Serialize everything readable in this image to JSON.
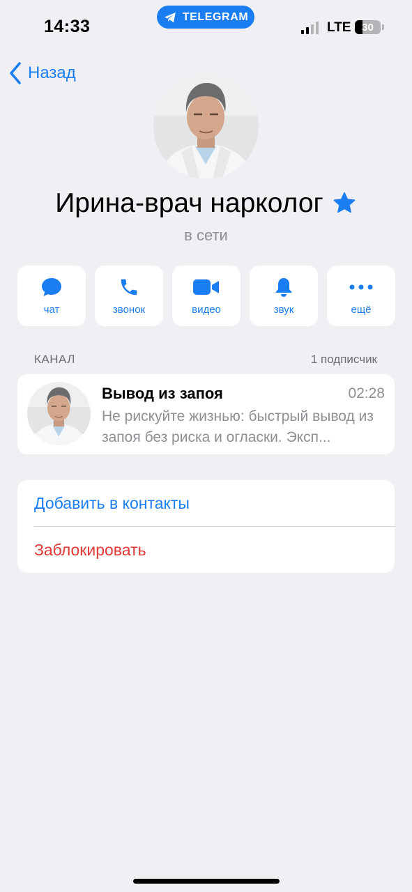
{
  "status_bar": {
    "time": "14:33",
    "app_pill": "TELEGRAM",
    "network": "LTE",
    "battery": "30",
    "battery_level": 0.3
  },
  "nav": {
    "back_label": "Назад"
  },
  "profile": {
    "name": "Ирина-врач нарколог",
    "status": "в сети",
    "badge_icon": "star-icon"
  },
  "actions": [
    {
      "label": "чат",
      "icon": "chat-bubble-icon"
    },
    {
      "label": "звонок",
      "icon": "phone-icon"
    },
    {
      "label": "видео",
      "icon": "video-camera-icon"
    },
    {
      "label": "звук",
      "icon": "bell-icon"
    },
    {
      "label": "ещё",
      "icon": "more-dots-icon"
    }
  ],
  "channel": {
    "section_title": "КАНАЛ",
    "subscribers": "1 подписчик",
    "name": "Вывод из запоя",
    "time": "02:28",
    "message": "Не рискуйте жизнью: быстрый вывод из запоя без риска и огласки. Эксп..."
  },
  "menu": {
    "add_contact": "Добавить в контакты",
    "block": "Заблокировать"
  },
  "colors": {
    "accent": "#1a7ef2",
    "danger": "#e53935",
    "background": "#efeff4",
    "secondary_text": "#8e8e93"
  }
}
